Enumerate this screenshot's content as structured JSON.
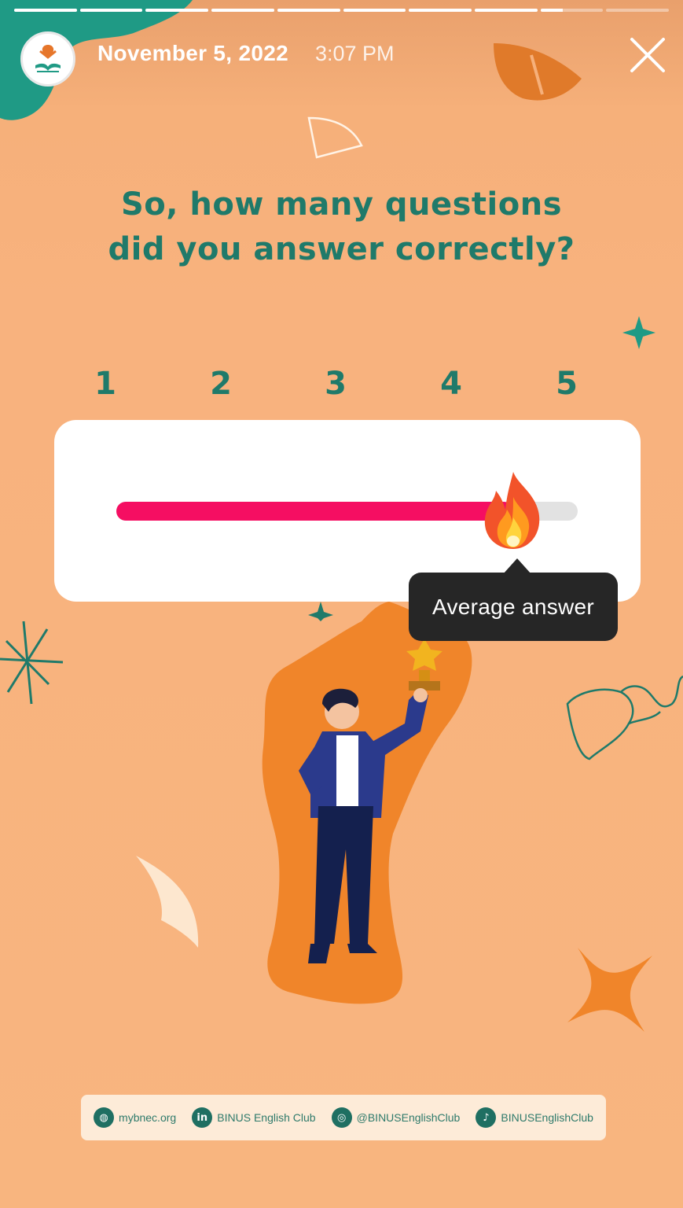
{
  "story": {
    "progress_segments": 10,
    "active_segment": 8,
    "active_fraction": 0.35
  },
  "header": {
    "date": "November 5, 2022",
    "time": "3:07 PM",
    "avatar_icon": "club-logo-icon",
    "close_icon": "close-icon"
  },
  "question": {
    "line1": "So, how many questions",
    "line2": "did you answer correctly?"
  },
  "scale": [
    "1",
    "2",
    "3",
    "4",
    "5"
  ],
  "slider": {
    "value": 0.86,
    "emoji": "fire",
    "fill_color": "#f50e62",
    "tooltip": "Average answer"
  },
  "footer": {
    "website": "mybnec.org",
    "linkedin": "BINUS English Club",
    "instagram": "@BINUSEnglishClub",
    "tiktok": "BINUSEnglishClub"
  },
  "colors": {
    "background": "#f8b27e",
    "text_teal": "#1f7a6a",
    "accent_orange": "#f0852a"
  }
}
